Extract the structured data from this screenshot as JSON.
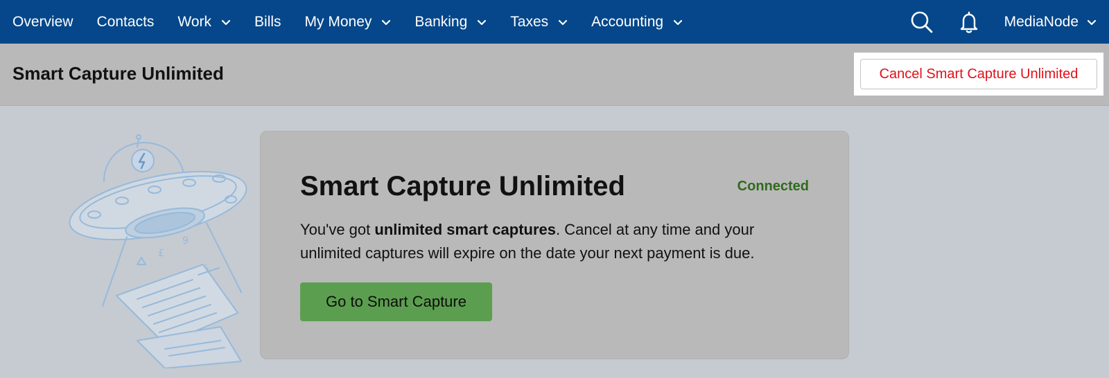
{
  "nav": {
    "items": [
      {
        "label": "Overview",
        "dropdown": false
      },
      {
        "label": "Contacts",
        "dropdown": false
      },
      {
        "label": "Work",
        "dropdown": true
      },
      {
        "label": "Bills",
        "dropdown": false
      },
      {
        "label": "My Money",
        "dropdown": true
      },
      {
        "label": "Banking",
        "dropdown": true
      },
      {
        "label": "Taxes",
        "dropdown": true
      },
      {
        "label": "Accounting",
        "dropdown": true
      }
    ],
    "account_label": "MediaNode",
    "icons": {
      "search": "search-icon",
      "notifications": "bell-icon"
    }
  },
  "header": {
    "title": "Smart Capture Unlimited",
    "cancel_label": "Cancel Smart Capture Unlimited"
  },
  "card": {
    "title": "Smart Capture Unlimited",
    "status": "Connected",
    "desc_pre": "You've got ",
    "desc_bold": "unlimited smart captures",
    "desc_post": ". Cancel at any time and your unlimited captures will expire on the date your next payment is due.",
    "button_label": "Go to Smart Capture"
  },
  "colors": {
    "nav_bg": "#05478a",
    "cancel_text": "#e0101a",
    "status_text": "#2f6a1d",
    "primary_button": "#5b9e4f"
  }
}
